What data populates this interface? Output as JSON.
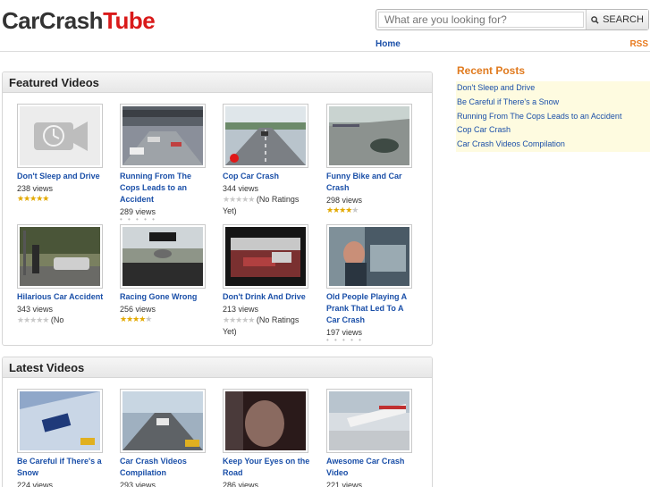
{
  "header": {
    "logo_part1": "CarCrash",
    "logo_part2": "Tube",
    "search_placeholder": "What are you looking for?",
    "search_button": "SEARCH",
    "nav_home": "Home",
    "nav_rss": "RSS"
  },
  "featured": {
    "heading": "Featured Videos",
    "items": [
      {
        "title": "Don't Sleep and Drive",
        "views": "238 views",
        "rating": 5,
        "rating_text": ""
      },
      {
        "title": "Running From The Cops Leads to an Accident",
        "views": "289 views",
        "rating": 0,
        "rating_text": ""
      },
      {
        "title": "Cop Car Crash",
        "views": "344 views",
        "rating": 0,
        "rating_text": "(No Ratings Yet)"
      },
      {
        "title": "Funny Bike and Car Crash",
        "views": "298 views",
        "rating": 4,
        "rating_text": ""
      },
      {
        "title": "Hilarious Car Accident",
        "views": "343 views",
        "rating": 0,
        "rating_text": "(No"
      },
      {
        "title": "Racing Gone Wrong",
        "views": "256 views",
        "rating": 4,
        "rating_text": ""
      },
      {
        "title": "Don't Drink And Drive",
        "views": "213 views",
        "rating": 0,
        "rating_text": "(No Ratings Yet)"
      },
      {
        "title": "Old People Playing A Prank That Led To A Car Crash",
        "views": "197 views",
        "rating": 0,
        "rating_text": ""
      }
    ]
  },
  "latest": {
    "heading": "Latest Videos",
    "items": [
      {
        "title": "Be Careful if There's a Snow",
        "views": "224 views"
      },
      {
        "title": "Car Crash Videos Compilation",
        "views": "293 views"
      },
      {
        "title": "Keep Your Eyes on the Road",
        "views": "286 views"
      },
      {
        "title": "Awesome Car Crash Video",
        "views": "221 views"
      }
    ]
  },
  "recent_posts": {
    "heading": "Recent Posts",
    "items": [
      "Don't Sleep and Drive",
      "Be Careful if There's a Snow",
      "Running From The Cops Leads to an Accident",
      "Cop Car Crash",
      "Car Crash Videos Compilation"
    ]
  },
  "colors": {
    "link": "#1a4fa8",
    "brand_red": "#d91a1a",
    "accent_orange": "#e07a1e",
    "star": "#e3a900"
  }
}
